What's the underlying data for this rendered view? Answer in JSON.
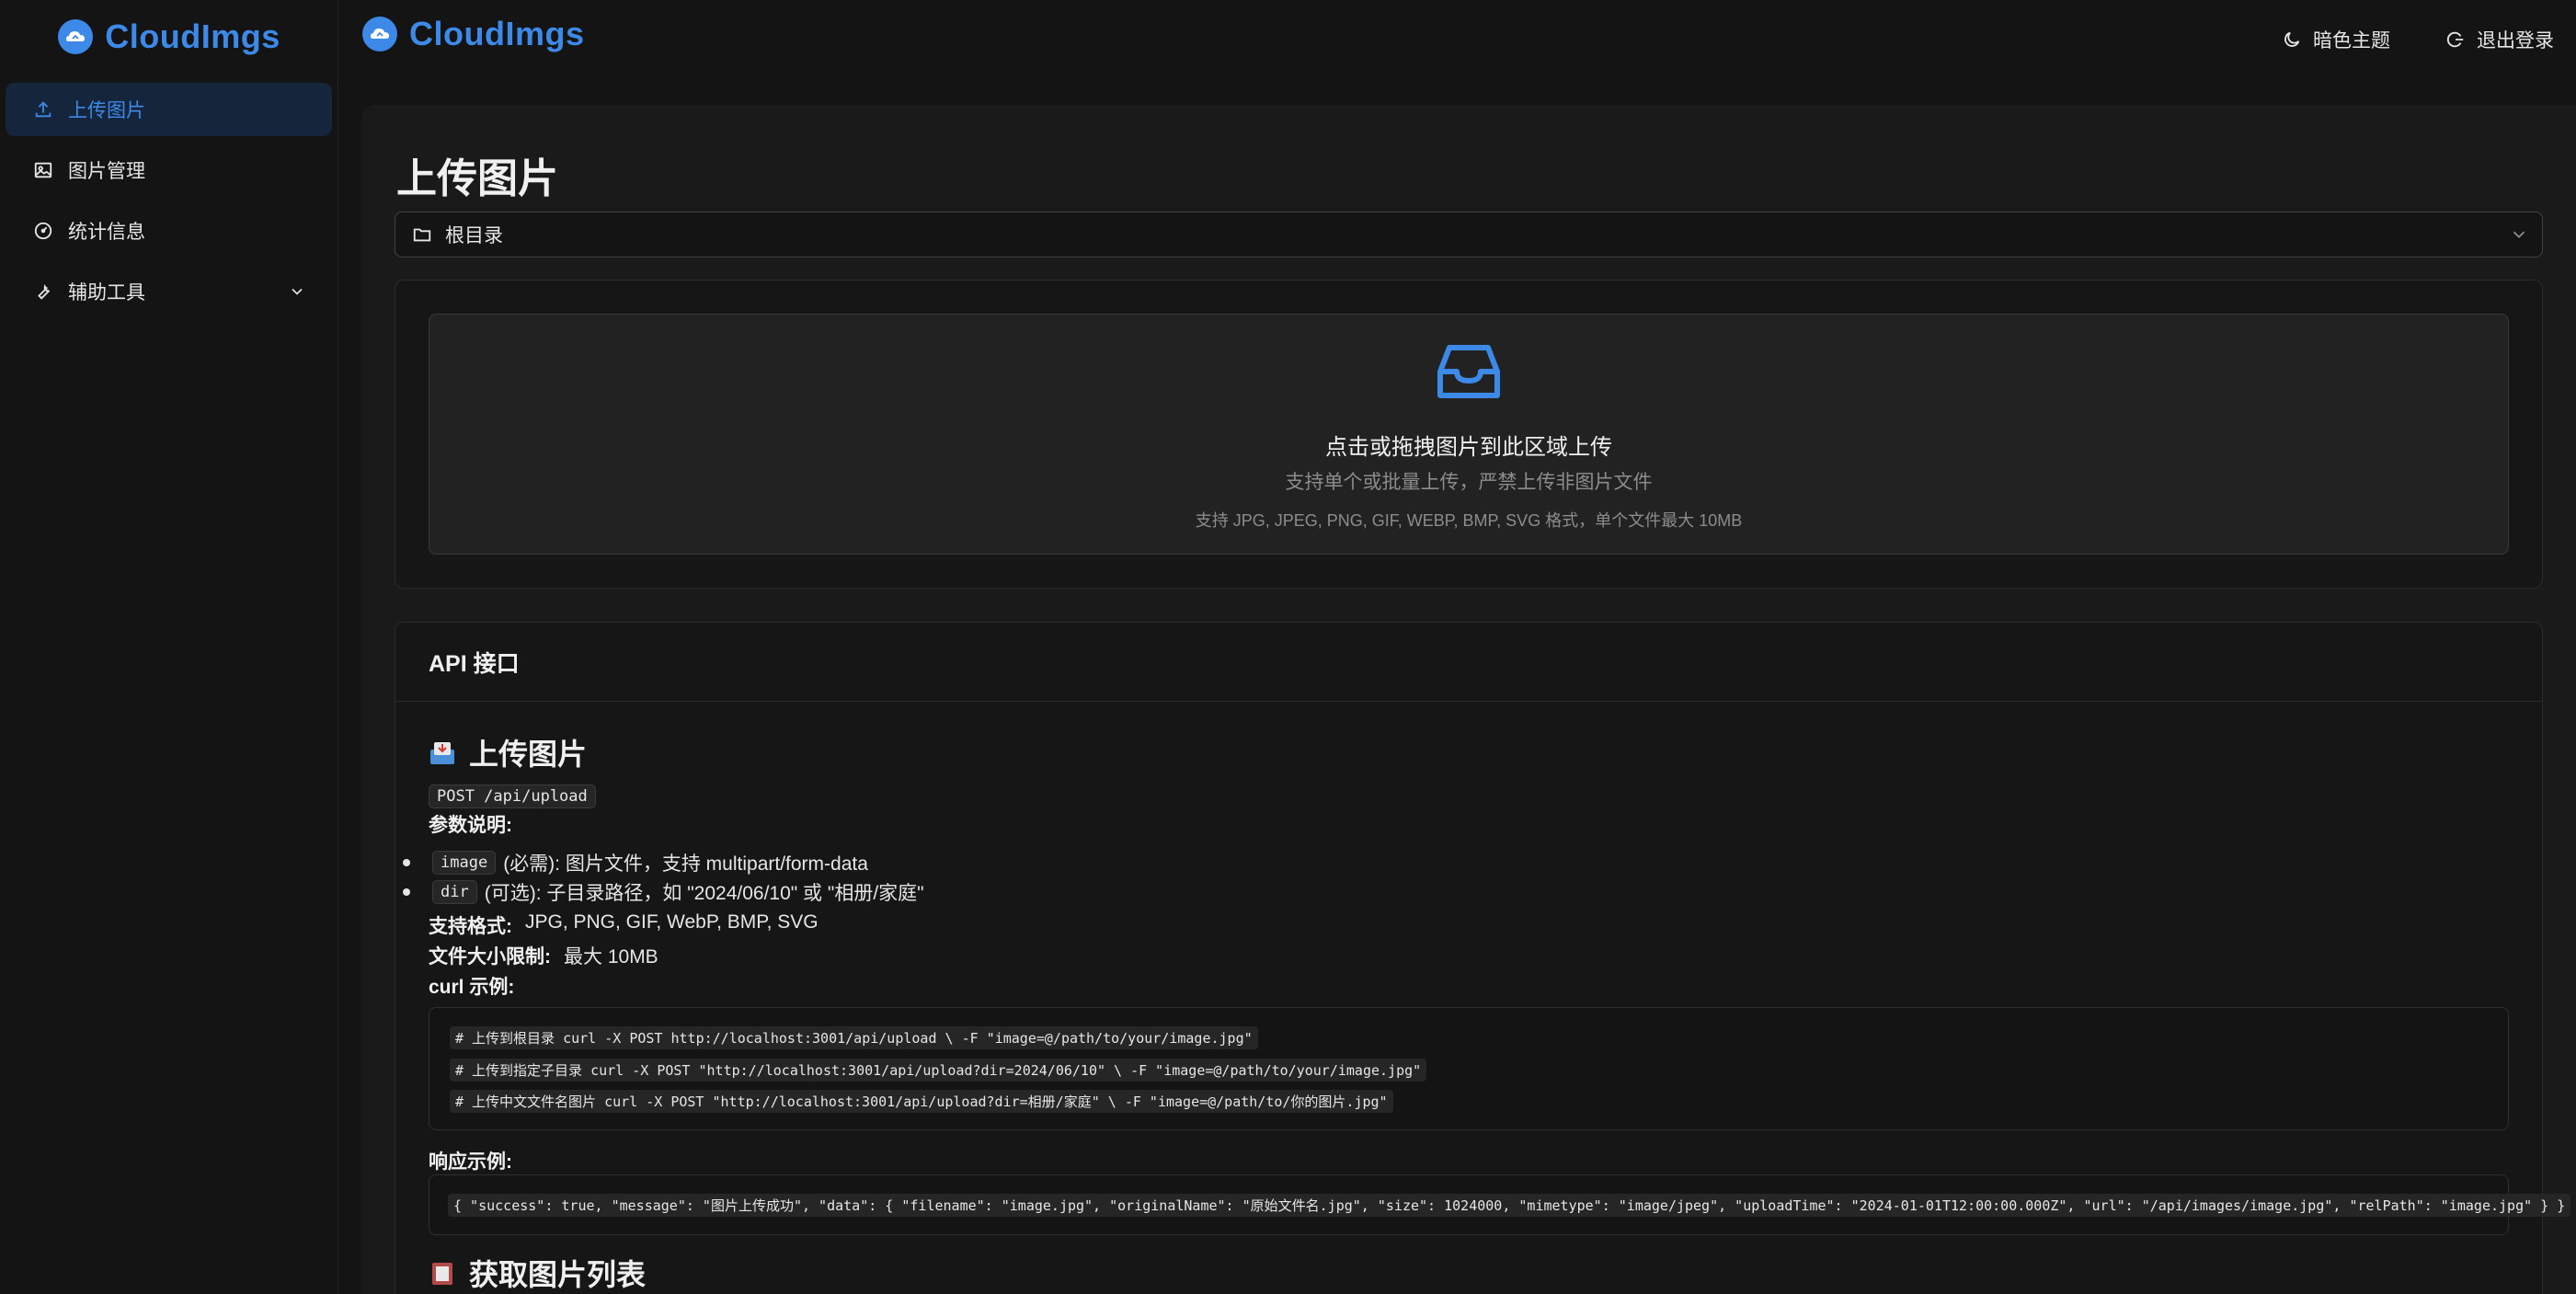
{
  "app": {
    "name": "CloudImgs"
  },
  "sidebar": {
    "items": [
      {
        "label": "上传图片",
        "active": true
      },
      {
        "label": "图片管理",
        "active": false
      },
      {
        "label": "统计信息",
        "active": false
      },
      {
        "label": "辅助工具",
        "active": false
      }
    ]
  },
  "header": {
    "theme_label": "暗色主题",
    "logout_label": "退出登录"
  },
  "page": {
    "title": "上传图片",
    "directory": "根目录"
  },
  "upload": {
    "title": "点击或拖拽图片到此区域上传",
    "subtitle": "支持单个或批量上传，严禁上传非图片文件",
    "hint": "支持 JPG, JPEG, PNG, GIF, WEBP, BMP, SVG 格式，单个文件最大 10MB"
  },
  "api": {
    "card_title": "API 接口",
    "upload_section": {
      "title": "上传图片",
      "endpoint": "POST /api/upload",
      "params_label": "参数说明:",
      "params": [
        {
          "name": "image",
          "desc": "(必需): 图片文件，支持 multipart/form-data"
        },
        {
          "name": "dir",
          "desc": "(可选): 子目录路径，如 \"2024/06/10\" 或 \"相册/家庭\""
        }
      ],
      "formats_label": "支持格式:",
      "formats_value": "JPG, PNG, GIF, WebP, BMP, SVG",
      "size_label": "文件大小限制:",
      "size_value": "最大 10MB",
      "curl_label": "curl 示例:",
      "curl_lines": [
        "# 上传到根目录 curl -X POST http://localhost:3001/api/upload \\ -F \"image=@/path/to/your/image.jpg\"",
        "# 上传到指定子目录 curl -X POST \"http://localhost:3001/api/upload?dir=2024/06/10\" \\ -F \"image=@/path/to/your/image.jpg\"",
        "# 上传中文文件名图片 curl -X POST \"http://localhost:3001/api/upload?dir=相册/家庭\" \\ -F \"image=@/path/to/你的图片.jpg\""
      ],
      "response_label": "响应示例:",
      "response": "{ \"success\": true, \"message\": \"图片上传成功\", \"data\": { \"filename\": \"image.jpg\", \"originalName\": \"原始文件名.jpg\", \"size\": 1024000, \"mimetype\": \"image/jpeg\", \"uploadTime\": \"2024-01-01T12:00:00.000Z\", \"url\": \"/api/images/image.jpg\", \"relPath\": \"image.jpg\" } }"
    },
    "list_section": {
      "title": "获取图片列表"
    }
  },
  "colors": {
    "accent": "#3c89e8",
    "background": "#141414",
    "content_bg": "#1a1a1a"
  },
  "icons": {
    "upload": "upload-icon",
    "picture": "picture-icon",
    "dashboard": "dashboard-icon",
    "tool": "tool-icon",
    "theme": "moon-icon",
    "logout": "logout-icon",
    "folder": "folder-icon",
    "inbox": "inbox-icon"
  }
}
